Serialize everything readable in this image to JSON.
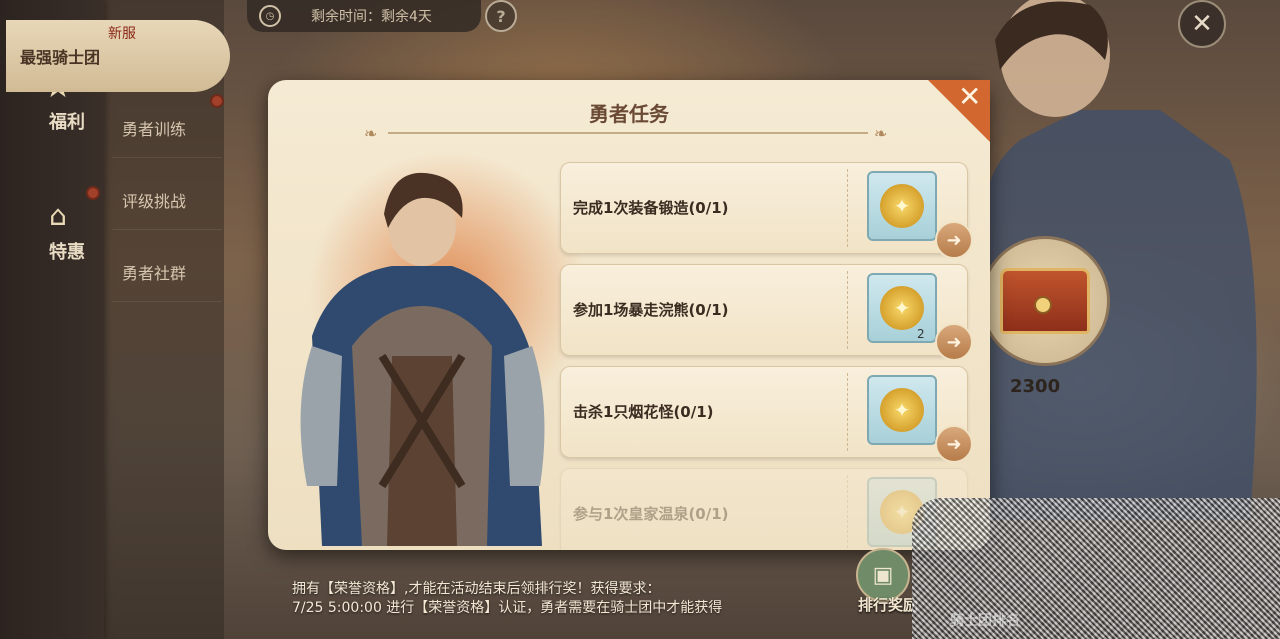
{
  "timer": {
    "text": "剩余时间：剩余4天"
  },
  "sidebar": {
    "welfare_label": "福利",
    "offer_label": "特惠"
  },
  "tabs": {
    "new_tag": "新服",
    "items": [
      "最强骑士团",
      "勇者训练",
      "评级挑战",
      "勇者社群"
    ]
  },
  "modal": {
    "title": "勇者任务",
    "tasks": [
      {
        "text": "完成1次装备锻造(0/1)",
        "reward_count": ""
      },
      {
        "text": "参加1场暴走浣熊(0/1)",
        "reward_count": "2"
      },
      {
        "text": "击杀1只烟花怪(0/1)",
        "reward_count": ""
      },
      {
        "text": "参与1次皇家温泉(0/1)",
        "reward_count": ""
      }
    ]
  },
  "right_panel": {
    "score": "2300"
  },
  "bottom": {
    "note_line1": "拥有【荣誉资格】,才能在活动结束后领排行奖！获得要求：",
    "note_line2": "7/25 5:00:00 进行【荣誉资格】认证，勇者需要在骑士团中才能获得",
    "rank_button": "排行奖励",
    "obscured_label": "骑士团排名"
  },
  "colors": {
    "accent": "#d2672f",
    "panel": "#f5ead3",
    "text_dark": "#3b2b20"
  }
}
